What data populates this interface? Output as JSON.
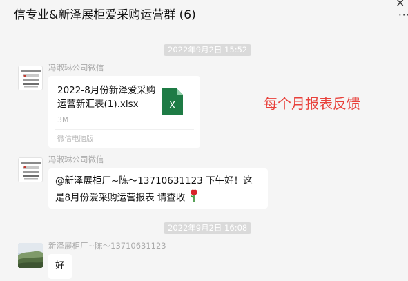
{
  "chat": {
    "title": "信专业&新泽展柜爱采购运营群 (6)",
    "window_controls": {
      "minimize": "···",
      "close": "×",
      "more": "···"
    }
  },
  "messages": {
    "time1": "2022年9月2日 15:52",
    "file_msg": {
      "sender": "冯淑琳公司微信",
      "file_name": "2022-8月份新泽爱采购运营新汇表(1).xlsx",
      "file_size": "3M",
      "source": "微信电脑版",
      "file_icon_letter": "X"
    },
    "annotation": "每个月报表反馈",
    "text_msg": {
      "sender": "冯淑琳公司微信",
      "text": "@新泽展柜厂~陈～13710631123 下午好！这是8月份爱采购运营报表 请查收",
      "emoji": "rose-emoji"
    },
    "time2": "2022年9月2日 16:08",
    "reply_msg": {
      "sender": "新泽展柜厂~陈～13710631123",
      "text": "好"
    }
  },
  "colors": {
    "annotation": "#e8403a",
    "excel_green": "#1e7b45",
    "background": "#f5f5f5"
  }
}
